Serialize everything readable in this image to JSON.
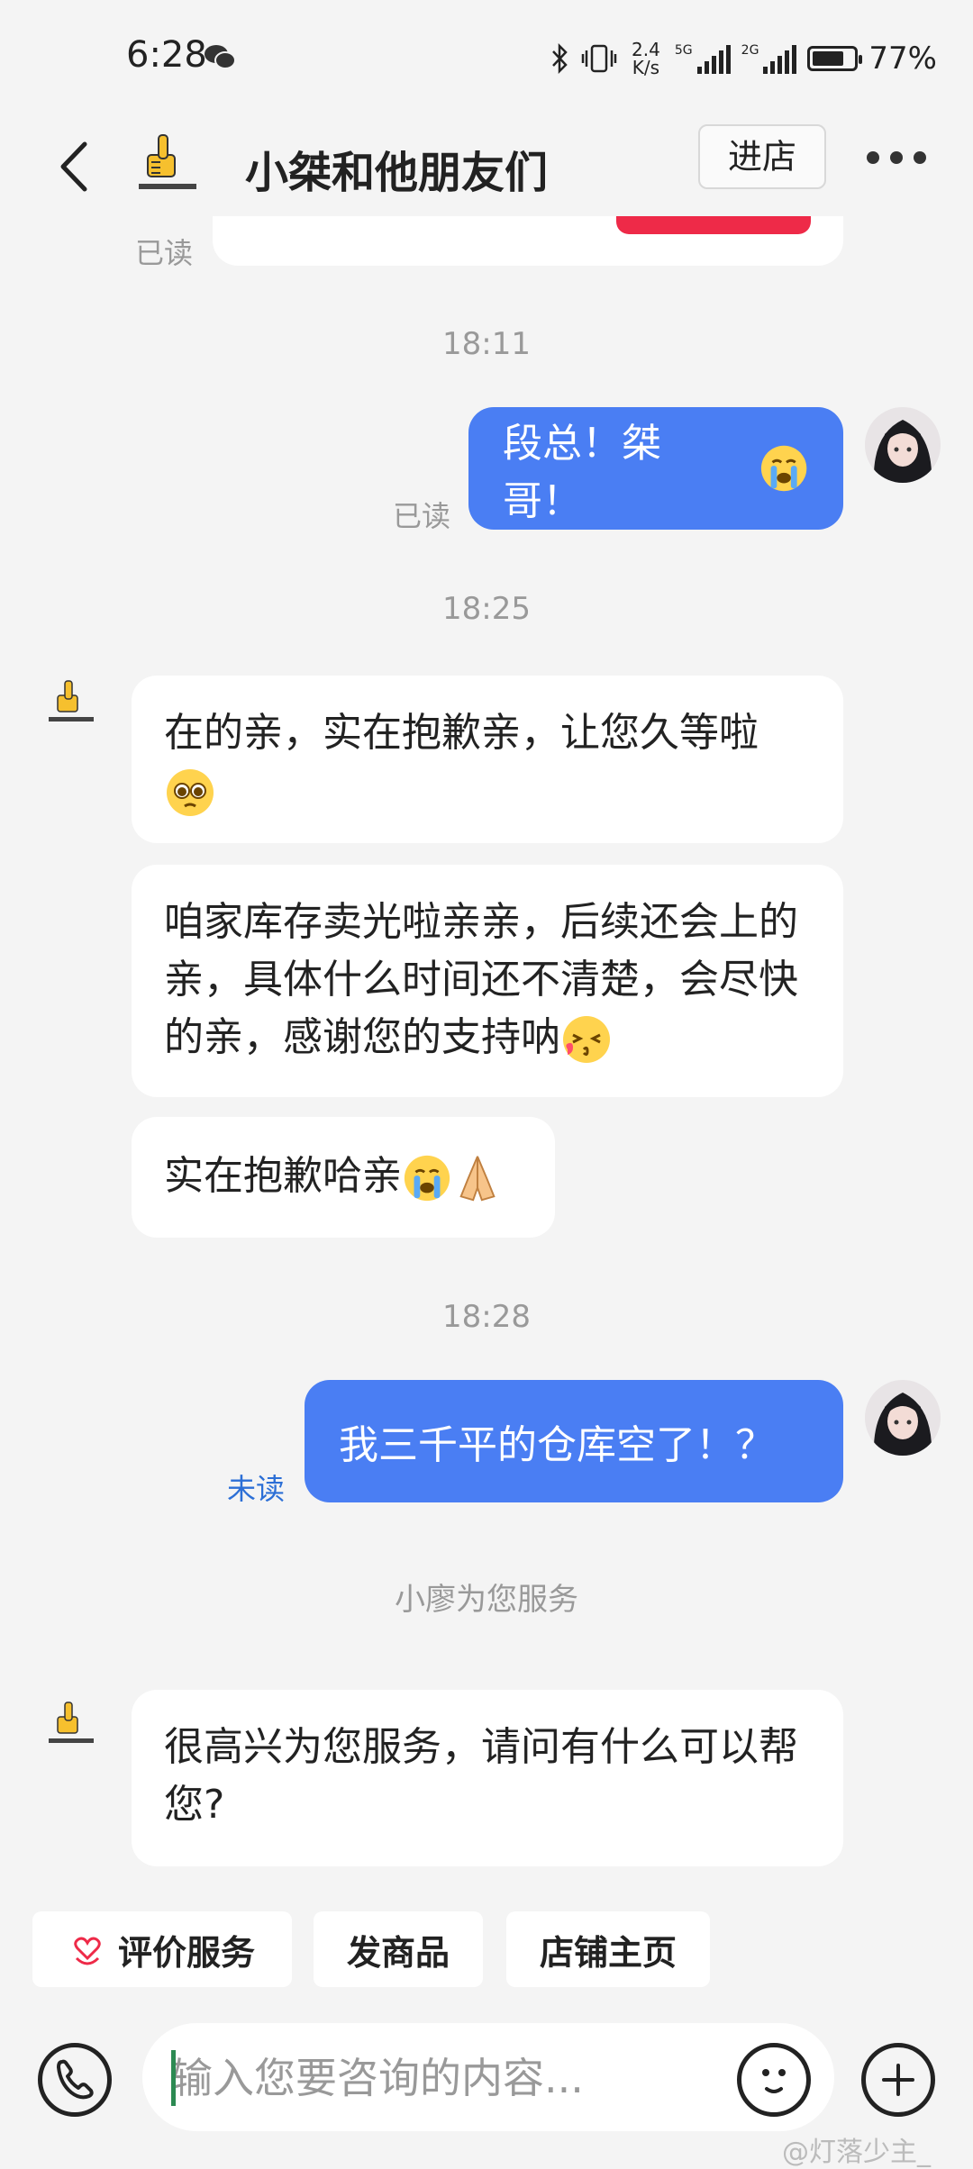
{
  "status": {
    "time": "6:28",
    "net_speed_top": "2.4",
    "net_speed_bottom": "K/s",
    "signal1": "5G",
    "signal2": "2G",
    "battery": "77%",
    "battery_level": 0.77
  },
  "header": {
    "shop_name": "小桀和他朋友们",
    "enter_label": "进店"
  },
  "messages": {
    "read_top": "已读",
    "time1": "18:11",
    "out1": "段总！桀哥！",
    "out1_status": "已读",
    "time2": "18:25",
    "in1_text": "在的亲，实在抱歉亲，让您久等啦",
    "in2_text": "咱家库存卖光啦亲亲，后续还会上的亲，具体什么时间还不清楚，会尽快的亲，感谢您的支持呐",
    "in3_text": "实在抱歉哈亲",
    "time3": "18:28",
    "out2": "我三千平的仓库空了！？",
    "out2_status": "未读",
    "system_note": "小廖为您服务",
    "in4_text": "很高兴为您服务，请问有什么可以帮您?"
  },
  "quick_actions": {
    "rate": "评价服务",
    "send_product": "发商品",
    "shop_home": "店铺主页"
  },
  "input": {
    "placeholder": "输入您要咨询的内容..."
  },
  "watermark": "@灯落少主_",
  "colors": {
    "outgoing_bubble": "#4a7ef3",
    "unread": "#2c6fd6",
    "accent_red": "#ee2a48"
  }
}
